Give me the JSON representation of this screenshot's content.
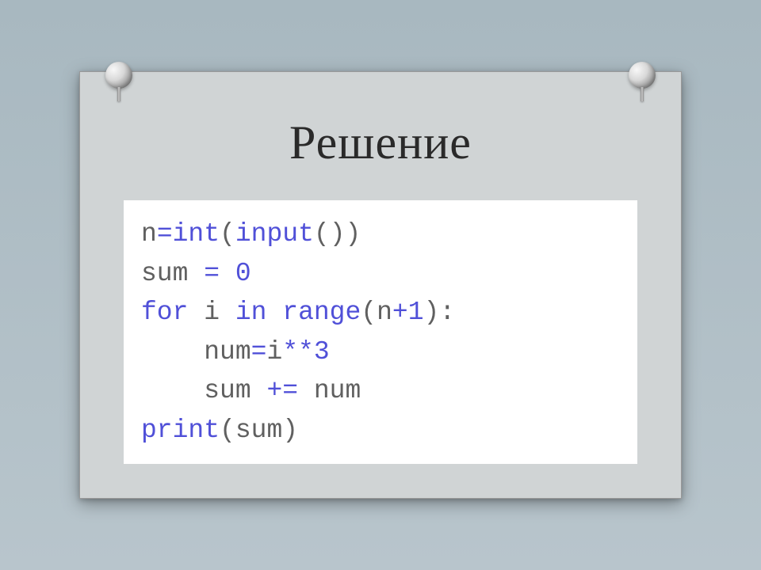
{
  "title": "Решение",
  "code": {
    "line1_a": "n",
    "line1_b": "=",
    "line1_c": "int",
    "line1_d": "(",
    "line1_e": "input",
    "line1_f": "())",
    "line2_a": "sum ",
    "line2_b": "=",
    "line2_c": " ",
    "line2_d": "0",
    "line3_a": "for",
    "line3_b": " i ",
    "line3_c": "in",
    "line3_d": " ",
    "line3_e": "range",
    "line3_f": "(n",
    "line3_g": "+",
    "line3_h": "1",
    "line3_i": "):",
    "line4_a": "    num",
    "line4_b": "=",
    "line4_c": "i",
    "line4_d": "**",
    "line4_e": "3",
    "line5_a": "    sum ",
    "line5_b": "+=",
    "line5_c": " num",
    "line6_a": "print",
    "line6_b": "(sum)"
  }
}
